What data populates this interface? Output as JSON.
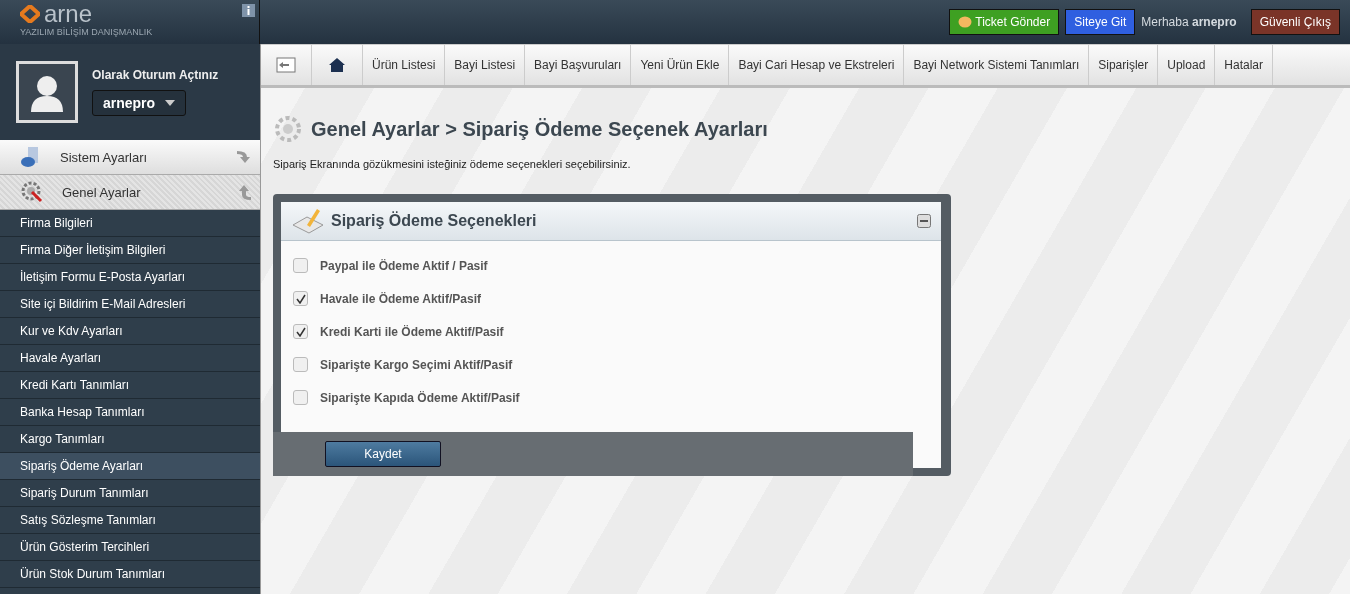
{
  "logo": {
    "name": "arne",
    "tagline": "YAZILIM BİLİŞİM DANIŞMANLIK"
  },
  "header": {
    "buttons": [
      {
        "kind": "ticket",
        "label": "Ticket Gönder"
      },
      {
        "kind": "site",
        "label": "Siteye Git"
      }
    ],
    "greeting": "Merhaba **arnepro**",
    "logout": "Güvenli Çıkış"
  },
  "user": {
    "status": "Olarak Oturum Açtınız",
    "name": "arnepro"
  },
  "sidebar": {
    "sections": [
      {
        "kind": "system",
        "label": "Sistem Ayarları",
        "expanded": false
      },
      {
        "kind": "general",
        "label": "Genel Ayarlar",
        "expanded": true
      }
    ],
    "items": [
      {
        "label": "Firma Bilgileri",
        "selected": false
      },
      {
        "label": "Firma Diğer İletişim Bilgileri",
        "selected": false
      },
      {
        "label": "İletişim Formu E-Posta Ayarları",
        "selected": false
      },
      {
        "label": "Site içi Bildirim E-Mail Adresleri",
        "selected": false
      },
      {
        "label": "Kur ve Kdv Ayarları",
        "selected": false
      },
      {
        "label": "Havale Ayarları",
        "selected": false
      },
      {
        "label": "Kredi Kartı Tanımları",
        "selected": false
      },
      {
        "label": "Banka Hesap Tanımları",
        "selected": false
      },
      {
        "label": "Kargo Tanımları",
        "selected": false
      },
      {
        "label": "Sipariş Ödeme Ayarları",
        "selected": true
      },
      {
        "label": "Sipariş Durum Tanımları",
        "selected": false
      },
      {
        "label": "Satış Sözleşme Tanımları",
        "selected": false
      },
      {
        "label": "Ürün Gösterim Tercihleri",
        "selected": false
      },
      {
        "label": "Ürün Stok Durum Tanımları",
        "selected": false
      }
    ]
  },
  "toolbar": {
    "tabs": [
      "Ürün Listesi",
      "Bayi Listesi",
      "Bayi Başvuruları",
      "Yeni Ürün Ekle",
      "Bayi Cari Hesap ve Ekstreleri",
      "Bayi Network Sistemi Tanımları",
      "Siparişler",
      "Upload",
      "Hatalar"
    ]
  },
  "page": {
    "title": "Genel Ayarlar > Sipariş Ödeme Seçenek Ayarları",
    "description": "Sipariş Ekranında gözükmesini isteğiniz ödeme seçenekleri seçebilirsiniz."
  },
  "panel": {
    "title": "Sipariş Ödeme Seçenekleri",
    "options": [
      {
        "label": "Paypal ile Ödeme Aktif / Pasif",
        "checked": false
      },
      {
        "label": "Havale ile Ödeme Aktif/Pasif",
        "checked": true
      },
      {
        "label": "Kredi Karti ile Ödeme Aktif/Pasif",
        "checked": true
      },
      {
        "label": "Siparişte Kargo Seçimi Aktif/Pasif",
        "checked": false
      },
      {
        "label": "Siparişte Kapıda Ödeme Aktif/Pasif",
        "checked": false
      }
    ],
    "save": "Kaydet"
  }
}
